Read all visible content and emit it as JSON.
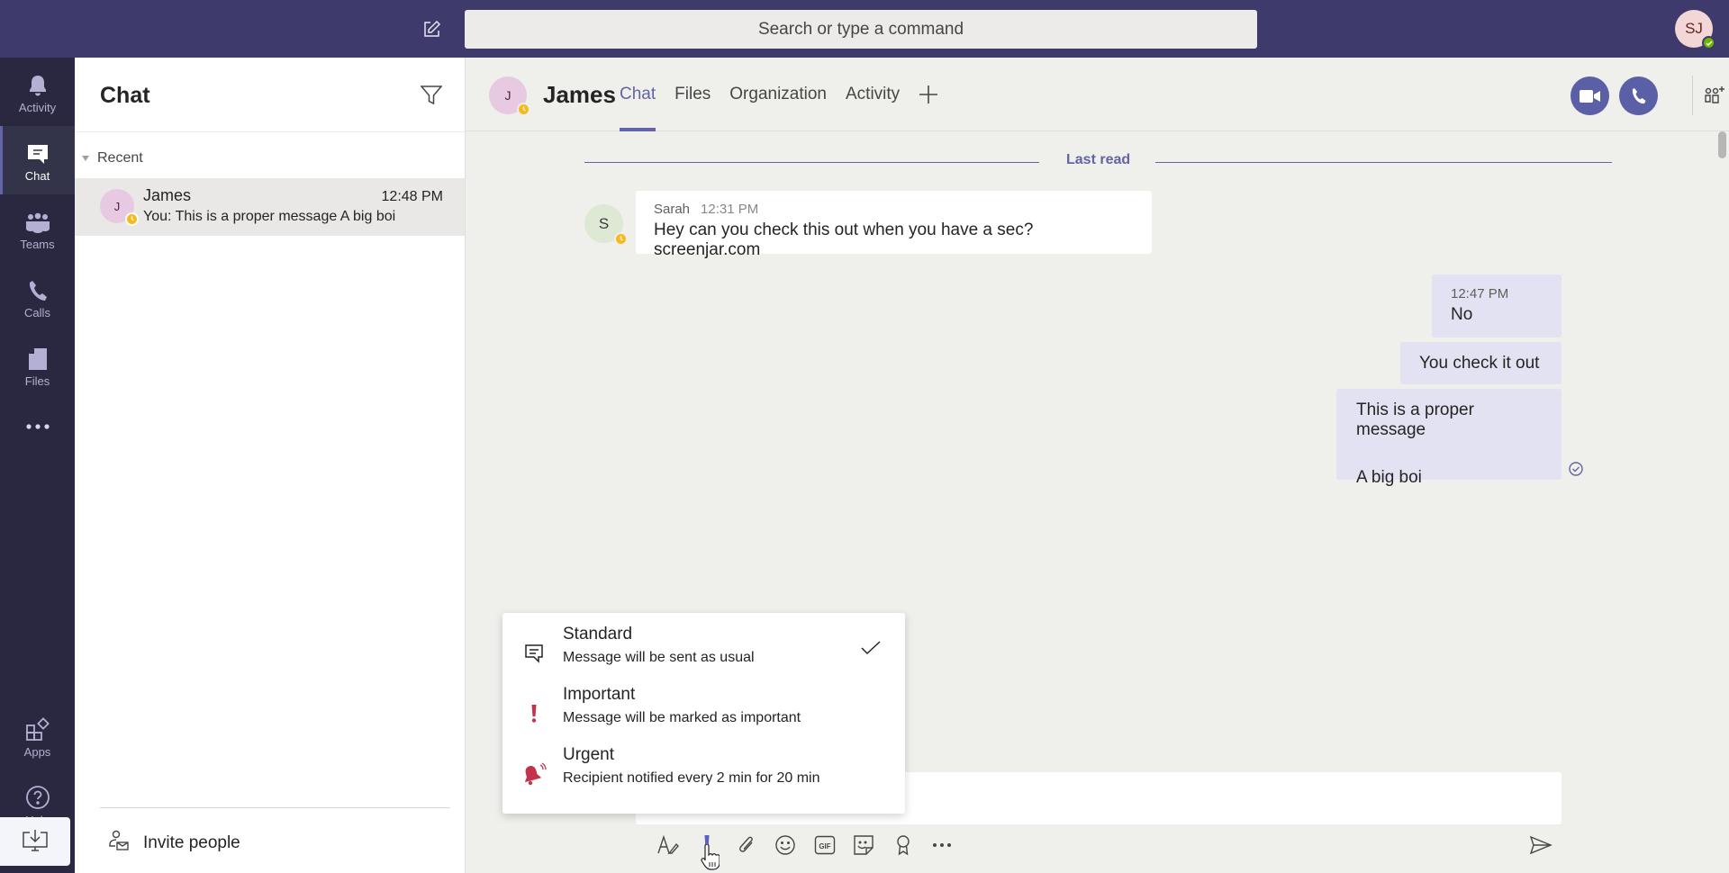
{
  "topbar": {
    "search_placeholder": "Search or type a command",
    "user_initials": "SJ",
    "user_status": "available",
    "status_color": "#6bb700",
    "brand_color": "#3e3a6b"
  },
  "rail": {
    "items": [
      {
        "label": "Activity",
        "icon": "bell-icon"
      },
      {
        "label": "Chat",
        "icon": "chat-icon",
        "active": true
      },
      {
        "label": "Teams",
        "icon": "teams-icon"
      },
      {
        "label": "Calls",
        "icon": "phone-icon"
      },
      {
        "label": "Files",
        "icon": "file-icon"
      }
    ],
    "more_icon": "more-horizontal-icon",
    "bottom_items": [
      {
        "label": "Apps",
        "icon": "apps-icon"
      },
      {
        "label": "Help",
        "icon": "help-icon"
      }
    ],
    "download_icon": "download-app-icon"
  },
  "chat_list": {
    "title": "Chat",
    "section_label": "Recent",
    "items": [
      {
        "initial": "J",
        "name": "James",
        "time": "12:48 PM",
        "preview": "You: This is a proper message A big boi",
        "status": "away"
      }
    ],
    "invite_label": "Invite people"
  },
  "conversation": {
    "contact_initial": "J",
    "contact_name": "James",
    "contact_status": "away",
    "tabs": [
      {
        "label": "Chat",
        "active": true
      },
      {
        "label": "Files"
      },
      {
        "label": "Organization"
      },
      {
        "label": "Activity"
      }
    ],
    "accent_color": "#6264a7",
    "last_read_label": "Last read",
    "messages": [
      {
        "direction": "incoming",
        "sender_initial": "S",
        "sender": "Sarah",
        "time": "12:31 PM",
        "text": "Hey can you check this out when you have a sec? screenjar.com"
      },
      {
        "direction": "outgoing",
        "time": "12:47 PM",
        "text": "No"
      },
      {
        "direction": "outgoing",
        "text": "You check it out"
      },
      {
        "direction": "outgoing",
        "lines": [
          "This is a proper message",
          "A big boi"
        ],
        "receipt": "seen"
      }
    ]
  },
  "compose": {
    "toolbar": [
      "format-icon",
      "importance-icon",
      "attach-icon",
      "emoji-icon",
      "gif-icon",
      "sticker-icon",
      "praise-icon",
      "more-options-icon"
    ],
    "send_icon": "send-icon"
  },
  "importance_menu": {
    "items": [
      {
        "title": "Standard",
        "description": "Message will be sent as usual",
        "selected": true
      },
      {
        "title": "Important",
        "description": "Message will be marked as important"
      },
      {
        "title": "Urgent",
        "description": "Recipient notified every 2 min for 20 min"
      }
    ],
    "important_color": "#c4314b"
  }
}
